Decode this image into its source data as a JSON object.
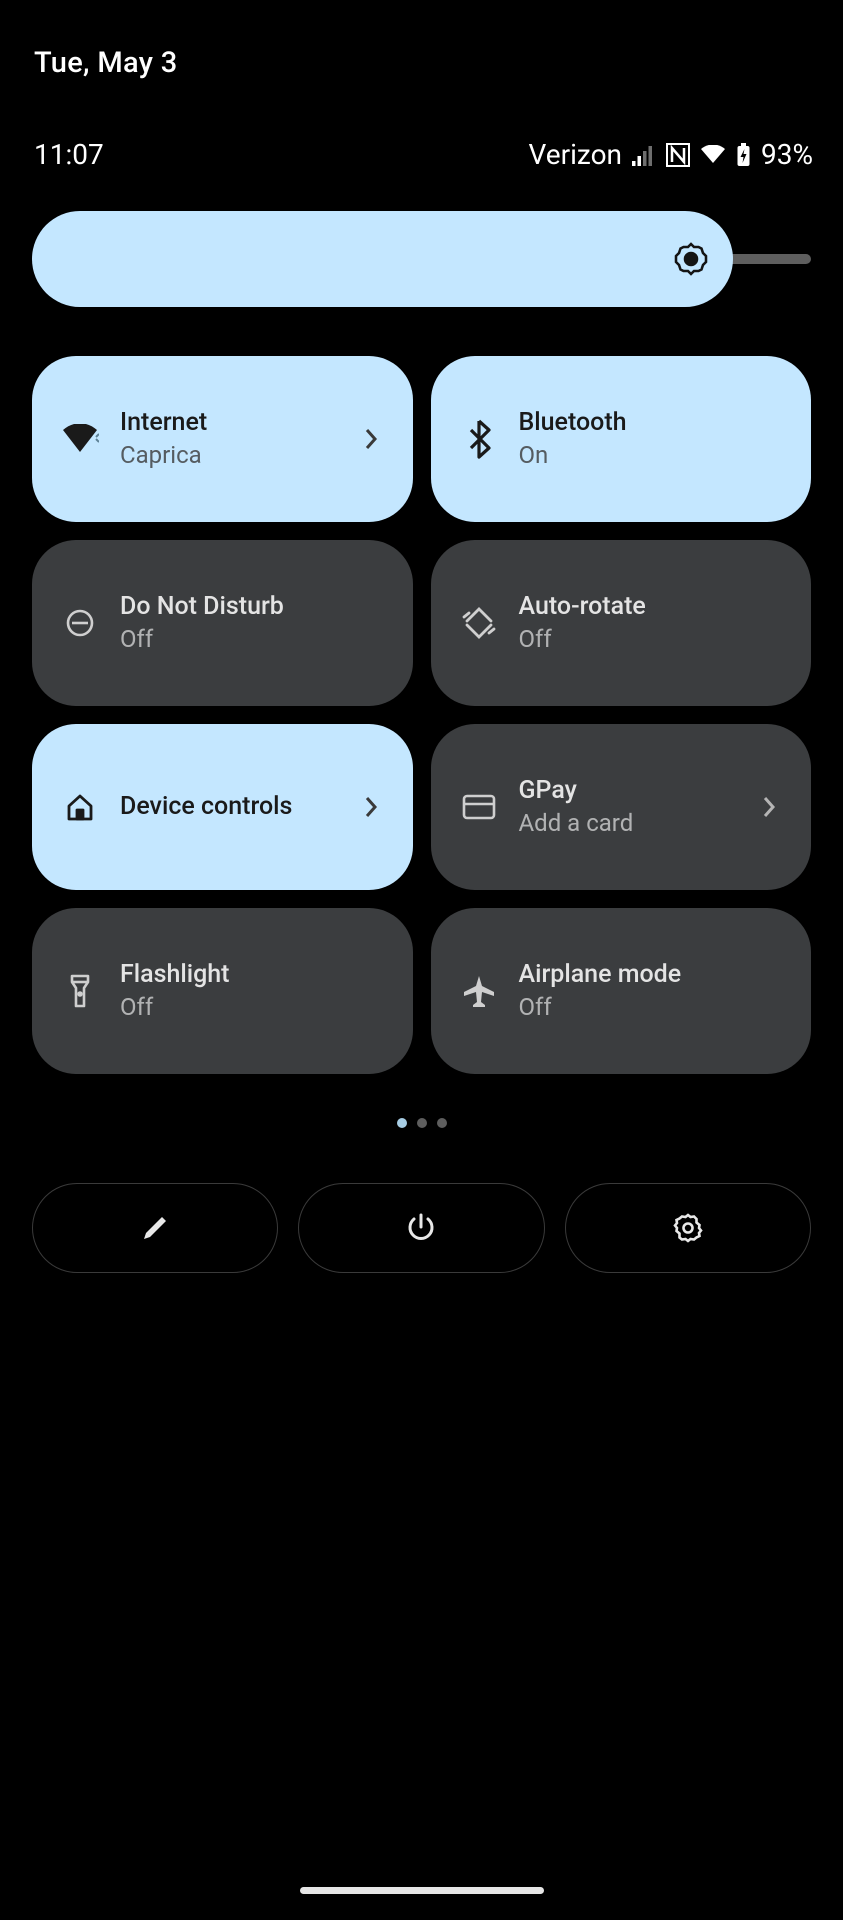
{
  "date": "Tue, May 3",
  "time": "11:07",
  "carrier": "Verizon",
  "battery": "93%",
  "tiles": [
    {
      "title": "Internet",
      "sub": "Caprica"
    },
    {
      "title": "Bluetooth",
      "sub": "On"
    },
    {
      "title": "Do Not Disturb",
      "sub": "Off"
    },
    {
      "title": "Auto-rotate",
      "sub": "Off"
    },
    {
      "title": "Device controls",
      "sub": ""
    },
    {
      "title": "GPay",
      "sub": "Add a card"
    },
    {
      "title": "Flashlight",
      "sub": "Off"
    },
    {
      "title": "Airplane mode",
      "sub": "Off"
    }
  ]
}
